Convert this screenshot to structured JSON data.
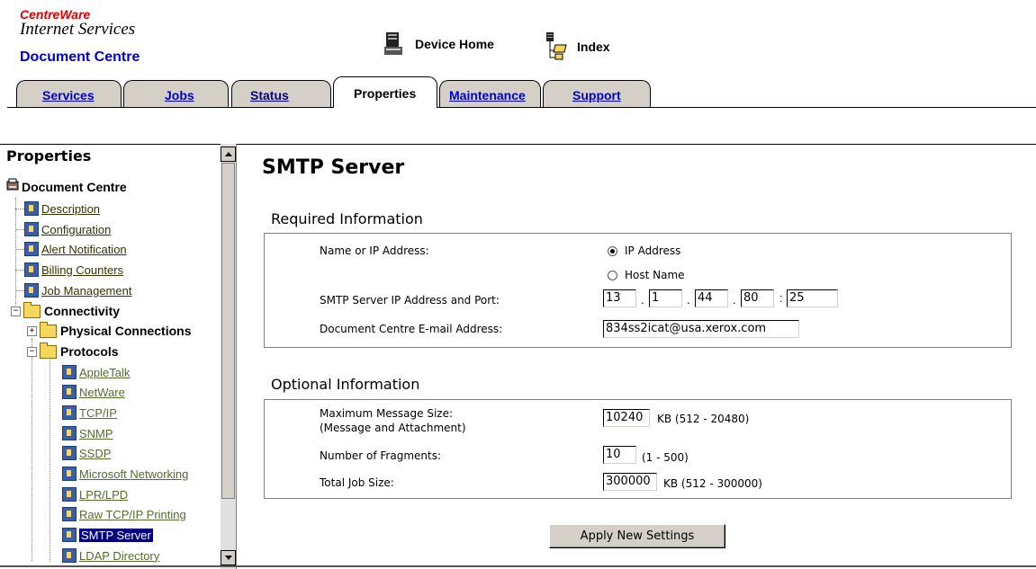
{
  "header": {
    "logo_line1": "CentreWare",
    "logo_line2": "Internet Services",
    "logo_line3": "Document Centre",
    "device_home": "Device Home",
    "index": "Index"
  },
  "tabs": [
    {
      "label": "Services"
    },
    {
      "label": "Jobs"
    },
    {
      "label": "Status"
    },
    {
      "label": "Properties",
      "active": true
    },
    {
      "label": "Maintenance"
    },
    {
      "label": "Support"
    }
  ],
  "sidebar": {
    "title": "Properties",
    "root": "Document Centre",
    "items": {
      "description": "Description",
      "configuration": "Configuration",
      "alert_notification": "Alert Notification",
      "billing_counters": "Billing Counters",
      "job_management": "Job Management",
      "connectivity": "Connectivity",
      "physical_connections": "Physical Connections",
      "protocols": "Protocols",
      "appletalk": "AppleTalk",
      "netware": "NetWare",
      "tcpip": "TCP/IP",
      "snmp": "SNMP",
      "ssdp": "SSDP",
      "microsoft_networking": "Microsoft Networking",
      "lpr_lpd": "LPR/LPD",
      "raw_tcpip": "Raw TCP/IP Printing",
      "smtp_server": "SMTP Server",
      "ldap_directory": "LDAP Directory"
    },
    "selected": "SMTP Server"
  },
  "main": {
    "title": "SMTP Server",
    "required": {
      "heading": "Required Information",
      "name_or_ip_label": "Name or IP Address:",
      "radio_ip": "IP Address",
      "radio_host": "Host Name",
      "selected_radio": "IP Address",
      "ip_port_label": "SMTP Server IP Address and Port:",
      "ip1": "13",
      "ip2": "1",
      "ip3": "44",
      "ip4": "80",
      "port": "25",
      "dot": ".",
      "colon": ":",
      "email_label": "Document Centre E-mail Address:",
      "email_value": "834ss2icat@usa.xerox.com"
    },
    "optional": {
      "heading": "Optional Information",
      "max_size_label": "Maximum Message Size:",
      "max_size_sublabel": "(Message and Attachment)",
      "max_size_value": "10240",
      "max_size_unit": "KB (512 - 20480)",
      "fragments_label": "Number of Fragments:",
      "fragments_value": "10",
      "fragments_unit": "(1 - 500)",
      "total_label": "Total Job Size:",
      "total_value": "300000",
      "total_unit": "KB (512 - 300000)"
    },
    "apply_button": "Apply New Settings"
  },
  "colors": {
    "link_blue": "#0000cc",
    "tab_gray": "#d4d0c8",
    "selection": "#000080",
    "logo_red": "#e00000"
  }
}
